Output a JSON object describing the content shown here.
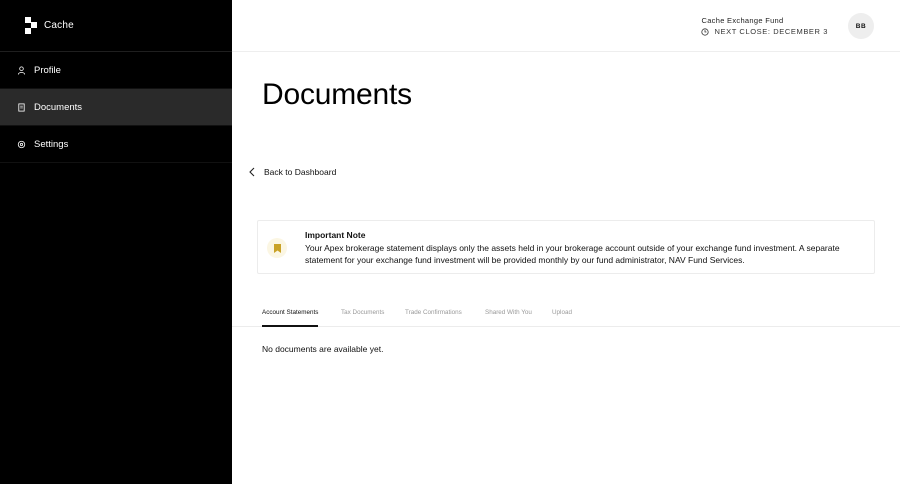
{
  "sidebar": {
    "brand": "Cache",
    "items": [
      {
        "label": "Profile",
        "icon": "user-icon"
      },
      {
        "label": "Documents",
        "icon": "document-icon",
        "active": true
      },
      {
        "label": "Settings",
        "icon": "gear-icon"
      }
    ]
  },
  "header": {
    "fund_name": "Cache Exchange Fund",
    "next_close": "NEXT CLOSE: DECEMBER 3",
    "avatar_initials": "BB"
  },
  "main": {
    "title": "Documents",
    "back_label": "Back to Dashboard",
    "note": {
      "title": "Important Note",
      "body": "Your Apex brokerage statement displays only the assets held in your brokerage account outside of your exchange fund investment. A separate statement for your exchange fund investment will be provided monthly by our fund administrator, NAV Fund Services.",
      "icon": "bookmark-icon",
      "icon_bg": "#fbf6e3",
      "icon_color": "#c9a227"
    },
    "tabs": [
      {
        "label": "Account Statements",
        "active": true
      },
      {
        "label": "Tax Documents"
      },
      {
        "label": "Trade Confirmations"
      },
      {
        "label": "Shared With You"
      },
      {
        "label": "Upload"
      }
    ],
    "empty_message": "No documents are available yet."
  }
}
